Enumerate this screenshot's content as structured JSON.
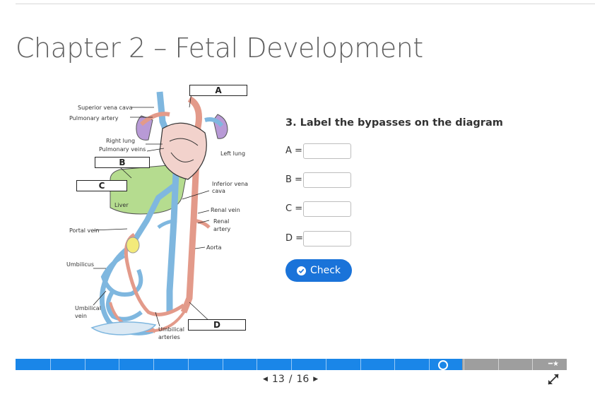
{
  "page": {
    "title": "Chapter 2 – Fetal Development"
  },
  "diagram": {
    "labels": {
      "superior_vena_cava": "Superior vena cava",
      "pulmonary_artery": "Pulmonary artery",
      "right_lung": "Right lung",
      "pulmonary_veins": "Pulmonary veins",
      "left_lung": "Left lung",
      "liver": "Liver",
      "inferior_vena_cava_1": "Inferior vena",
      "inferior_vena_cava_2": "cava",
      "renal_vein": "Renal vein",
      "renal_artery_1": "Renal",
      "renal_artery_2": "artery",
      "portal_vein": "Portal vein",
      "aorta": "Aorta",
      "umbilicus": "Umbilicus",
      "umbilical_vein_1": "Umbilical",
      "umbilical_vein_2": "vein",
      "umbilical_arteries_1": "Umbilical",
      "umbilical_arteries_2": "arteries"
    },
    "boxes": {
      "a": "A",
      "b": "B",
      "c": "C",
      "d": "D"
    }
  },
  "question": {
    "text": "3. Label the bypasses on the diagram",
    "answers": [
      {
        "label": "A =",
        "value": ""
      },
      {
        "label": "B =",
        "value": ""
      },
      {
        "label": "C =",
        "value": ""
      },
      {
        "label": "D =",
        "value": ""
      }
    ],
    "check_label": "Check"
  },
  "progress": {
    "current": 13,
    "total": 16,
    "fraction_complete": 0.81
  },
  "pager": {
    "current": "13",
    "separator": "/",
    "total": "16"
  },
  "colors": {
    "accent": "#1a73d9",
    "progress_fill": "#1a86e8",
    "progress_empty": "#9e9e9e",
    "vein": "#7fb7df",
    "artery": "#e39a8a",
    "lung": "#b89ad6",
    "liver": "#b5dc8f"
  },
  "icons": {
    "check": "check-circle-icon",
    "prev": "triangle-left-icon",
    "next": "triangle-right-icon",
    "fullscreen": "expand-icon",
    "star": "star-icon"
  }
}
